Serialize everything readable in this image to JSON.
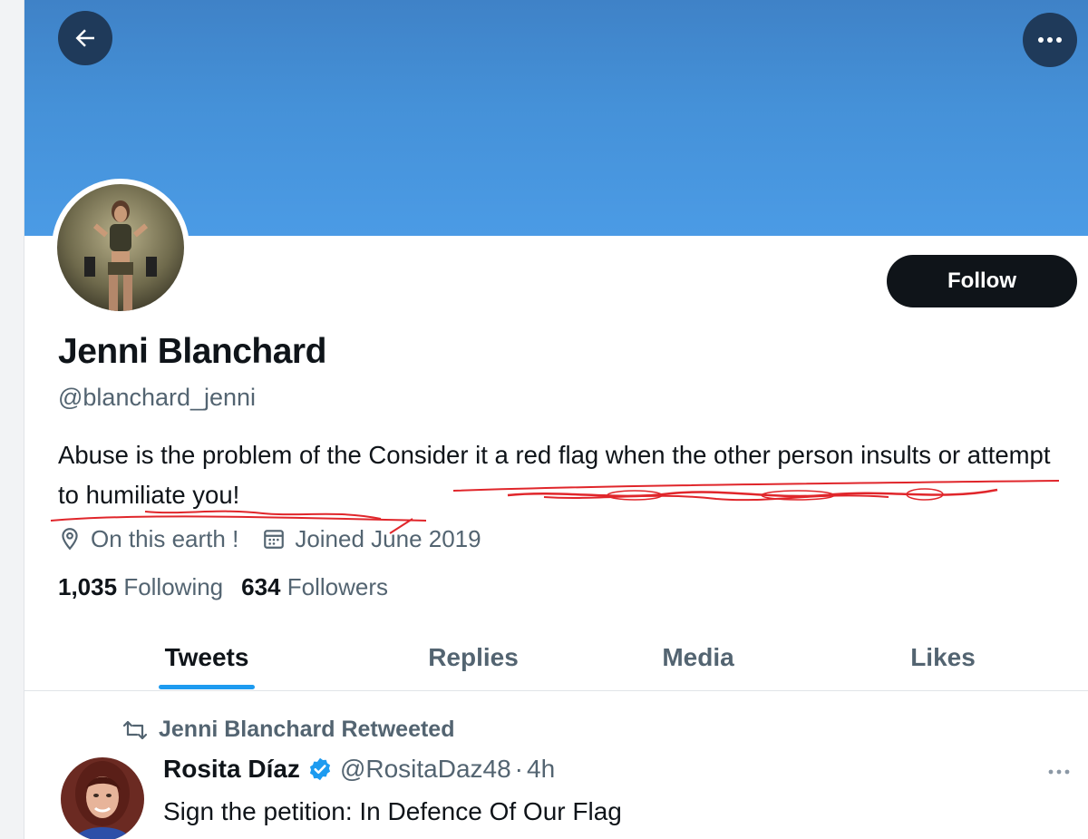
{
  "header": {
    "back_icon": "arrow-left-icon",
    "more_icon": "ellipsis-icon"
  },
  "profile": {
    "name": "Jenni Blanchard",
    "handle": "@blanchard_jenni",
    "bio": "Abuse is the problem of the Consider it a red flag when the other person insults or attempt to humiliate you!",
    "location": "On this earth !",
    "joined": "Joined June 2019",
    "following_count": "1,035",
    "following_label": "Following",
    "followers_count": "634",
    "followers_label": "Followers",
    "follow_button": "Follow"
  },
  "tabs": [
    {
      "label": "Tweets",
      "active": true
    },
    {
      "label": "Replies",
      "active": false
    },
    {
      "label": "Media",
      "active": false
    },
    {
      "label": "Likes",
      "active": false
    }
  ],
  "tweet": {
    "retweet_label": "Jenni Blanchard Retweeted",
    "author": "Rosita Díaz",
    "handle": "@RositaDaz48",
    "separator": "·",
    "time": "4h",
    "text": "Sign the petition: In Defence Of Our Flag"
  },
  "colors": {
    "banner": "#4a96df",
    "accent": "#1d9bf0",
    "annotation": "#e0262b",
    "follow_bg": "#0f1419"
  }
}
